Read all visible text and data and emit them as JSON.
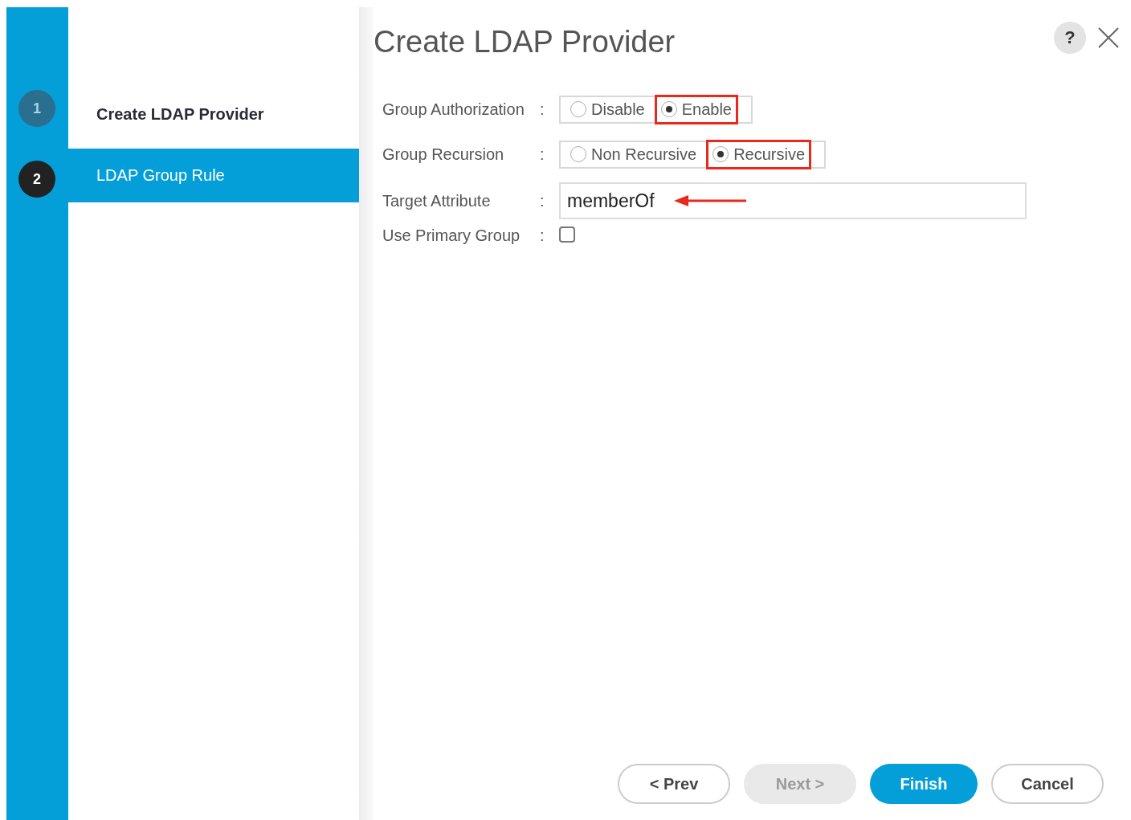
{
  "steps": [
    {
      "number": "1",
      "label": "Create LDAP Provider",
      "selected": false
    },
    {
      "number": "2",
      "label": "LDAP Group Rule",
      "selected": true
    }
  ],
  "dialog": {
    "title": "Create LDAP Provider",
    "help": "?"
  },
  "fields": [
    {
      "kind": "radio",
      "label": "Group Authorization",
      "separator": ":",
      "options": [
        {
          "label": "Disable",
          "selected": false,
          "highlighted": false
        },
        {
          "label": "Enable",
          "selected": true,
          "highlighted": true
        }
      ]
    },
    {
      "kind": "radio",
      "label": "Group Recursion",
      "separator": ":",
      "options": [
        {
          "label": "Non Recursive",
          "selected": false,
          "highlighted": false
        },
        {
          "label": "Recursive",
          "selected": true,
          "highlighted": true
        }
      ]
    },
    {
      "kind": "text",
      "label": "Target Attribute",
      "separator": ":",
      "value": "memberOf",
      "arrow": true
    },
    {
      "kind": "checkbox",
      "label": "Use Primary Group",
      "separator": ":",
      "checked": false
    }
  ],
  "buttons": [
    {
      "label": "< Prev",
      "kind": "secondary",
      "disabled": false
    },
    {
      "label": "Next >",
      "kind": "secondary",
      "disabled": true
    },
    {
      "label": "Finish",
      "kind": "primary",
      "disabled": false
    },
    {
      "label": "Cancel",
      "kind": "secondary",
      "disabled": false
    }
  ]
}
